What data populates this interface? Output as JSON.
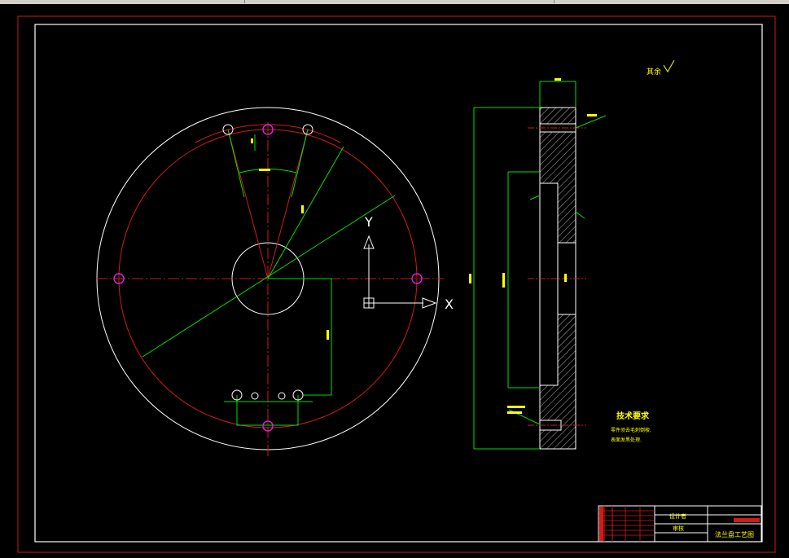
{
  "colors": {
    "background": "#000000",
    "frame": "#d11a1a",
    "outline": "#ffffff",
    "centerline": "#d11a1a",
    "dimension": "#00e000",
    "holes_accent": "#e020e0",
    "text": "#ffff00"
  },
  "ucs": {
    "x_label": "X",
    "y_label": "Y"
  },
  "annotations": {
    "roughness_note": "其余",
    "tech_title": "技术要求",
    "tech_lines": [
      "零件须去毛刺倒棱.",
      "表面发黑处理."
    ]
  },
  "title_block": {
    "drawing_name": "法兰盘工艺图",
    "labels": [
      "设计者",
      "审核"
    ]
  }
}
